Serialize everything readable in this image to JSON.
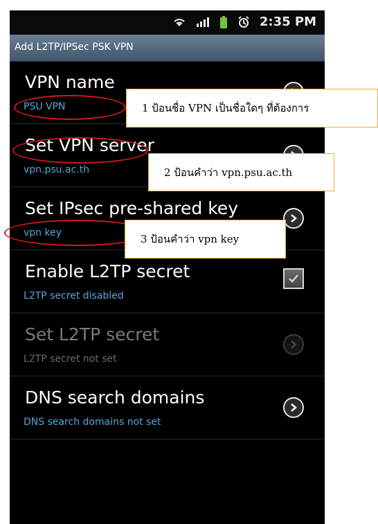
{
  "status": {
    "time": "2:35 PM",
    "icons": [
      "wifi-icon",
      "signal-icon",
      "battery-icon",
      "alarm-icon"
    ]
  },
  "title": "Add L2TP/IPSec PSK VPN",
  "items": [
    {
      "title": "VPN name",
      "subtitle": "PSU VPN",
      "control": "chevron",
      "enabled": true
    },
    {
      "title": "Set VPN server",
      "subtitle": "vpn.psu.ac.th",
      "control": "chevron",
      "enabled": true
    },
    {
      "title": "Set IPsec pre-shared key",
      "subtitle": "vpn key",
      "control": "chevron",
      "enabled": true
    },
    {
      "title": "Enable L2TP secret",
      "subtitle": "L2TP secret disabled",
      "control": "checkbox",
      "checked": true,
      "enabled": true
    },
    {
      "title": "Set L2TP secret",
      "subtitle": "L2TP secret not set",
      "control": "chevron",
      "enabled": false
    },
    {
      "title": "DNS search domains",
      "subtitle": "DNS search domains not set",
      "control": "chevron",
      "enabled": true
    }
  ],
  "annotations": [
    {
      "text": "1 ป้อนชื่อ VPN เป็นชื่อใดๆ ที่ต้องการ"
    },
    {
      "text": "2 ป้อนคำว่า vpn.psu.ac.th"
    },
    {
      "text": "3 ป้อนคำว่า vpn key"
    }
  ],
  "colors": {
    "accent": "#57a7dc",
    "highlight": "#d21a1a",
    "callout_border": "#f2a93b"
  }
}
